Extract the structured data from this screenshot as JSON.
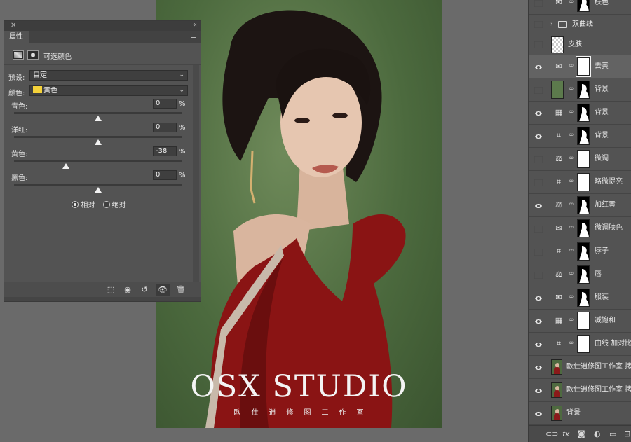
{
  "canvas": {
    "title_text": "OSX STUDIO",
    "subtitle_text": "欧仕逍修图工作室"
  },
  "properties": {
    "tab_label": "属性",
    "adjustment_title": "可选颜色",
    "preset_label": "预设:",
    "preset_value": "自定",
    "color_label": "颜色:",
    "color_value": "黄色",
    "color_swatch": "#f4d23a",
    "sliders": [
      {
        "label": "青色:",
        "value": "0",
        "unit": "%",
        "position": 0.5
      },
      {
        "label": "洋红:",
        "value": "0",
        "unit": "%",
        "position": 0.5
      },
      {
        "label": "黄色:",
        "value": "-38",
        "unit": "%",
        "position": 0.31
      },
      {
        "label": "黑色:",
        "value": "0",
        "unit": "%",
        "position": 0.5
      }
    ],
    "radio_relative": "相对",
    "radio_absolute": "绝对",
    "selected_mode": "relative"
  },
  "layers": {
    "items": [
      {
        "name": "肤色",
        "visible": false,
        "kind": "adjustment",
        "icon": "selective-color-icon"
      },
      {
        "name": "双曲线",
        "visible": false,
        "kind": "group"
      },
      {
        "name": "皮肤",
        "visible": false,
        "kind": "pixel"
      },
      {
        "name": "去黄",
        "visible": true,
        "kind": "adjustment",
        "icon": "selective-color-icon",
        "selected": true
      },
      {
        "name": "背景",
        "visible": false,
        "kind": "fill"
      },
      {
        "name": "背景",
        "visible": true,
        "kind": "adjustment",
        "icon": "channel-mixer-icon"
      },
      {
        "name": "背景",
        "visible": true,
        "kind": "adjustment",
        "icon": "curves-icon"
      },
      {
        "name": "微调",
        "visible": false,
        "kind": "adjustment",
        "icon": "color-balance-icon"
      },
      {
        "name": "略微提亮",
        "visible": false,
        "kind": "adjustment",
        "icon": "curves-icon"
      },
      {
        "name": "加红黄",
        "visible": true,
        "kind": "adjustment",
        "icon": "color-balance-icon"
      },
      {
        "name": "微调肤色",
        "visible": false,
        "kind": "adjustment",
        "icon": "selective-color-icon"
      },
      {
        "name": "脖子",
        "visible": false,
        "kind": "adjustment",
        "icon": "curves-icon"
      },
      {
        "name": "唇",
        "visible": false,
        "kind": "adjustment",
        "icon": "color-balance-icon"
      },
      {
        "name": "服装",
        "visible": true,
        "kind": "adjustment",
        "icon": "selective-color-icon"
      },
      {
        "name": "减饱和",
        "visible": true,
        "kind": "adjustment",
        "icon": "channel-mixer-icon"
      },
      {
        "name": "曲线 加对比",
        "visible": true,
        "kind": "adjustment",
        "icon": "curves-icon"
      },
      {
        "name": "欧仕逍修图工作室 拷贝",
        "visible": true,
        "kind": "photo"
      },
      {
        "name": "欧仕逍修图工作室 拷贝",
        "visible": true,
        "kind": "photo"
      },
      {
        "name": "背景",
        "visible": true,
        "kind": "photo"
      }
    ]
  }
}
